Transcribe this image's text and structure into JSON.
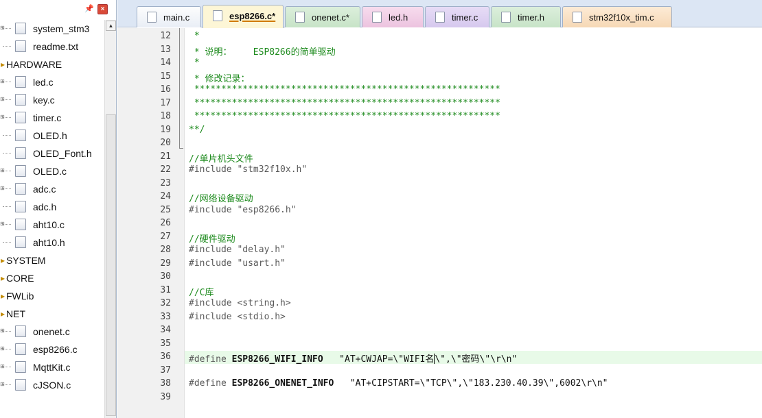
{
  "tree": {
    "items": [
      {
        "kind": "file",
        "label": "system_stm3",
        "expand": "+"
      },
      {
        "kind": "file",
        "label": "readme.txt",
        "expand": ""
      },
      {
        "kind": "group",
        "label": "HARDWARE"
      },
      {
        "kind": "file",
        "label": "led.c",
        "expand": "+"
      },
      {
        "kind": "file",
        "label": "key.c",
        "expand": "+"
      },
      {
        "kind": "file",
        "label": "timer.c",
        "expand": "+"
      },
      {
        "kind": "file",
        "label": "OLED.h",
        "expand": ""
      },
      {
        "kind": "file",
        "label": "OLED_Font.h",
        "expand": ""
      },
      {
        "kind": "file",
        "label": "OLED.c",
        "expand": "+"
      },
      {
        "kind": "file",
        "label": "adc.c",
        "expand": "+"
      },
      {
        "kind": "file",
        "label": "adc.h",
        "expand": ""
      },
      {
        "kind": "file",
        "label": "aht10.c",
        "expand": "+"
      },
      {
        "kind": "file",
        "label": "aht10.h",
        "expand": ""
      },
      {
        "kind": "group",
        "label": "SYSTEM"
      },
      {
        "kind": "group",
        "label": "CORE"
      },
      {
        "kind": "group",
        "label": "FWLib"
      },
      {
        "kind": "group",
        "label": "NET"
      },
      {
        "kind": "file",
        "label": "onenet.c",
        "expand": "+"
      },
      {
        "kind": "file",
        "label": "esp8266.c",
        "expand": "+"
      },
      {
        "kind": "file",
        "label": "MqttKit.c",
        "expand": "+"
      },
      {
        "kind": "file",
        "label": "cJSON.c",
        "expand": "+"
      }
    ]
  },
  "tabs": [
    {
      "label": "main.c",
      "style": "plain",
      "active": false
    },
    {
      "label": "esp8266.c*",
      "style": "active",
      "active": true
    },
    {
      "label": "onenet.c*",
      "style": "green",
      "active": false
    },
    {
      "label": "led.h",
      "style": "pink",
      "active": false
    },
    {
      "label": "timer.c",
      "style": "purple",
      "active": false
    },
    {
      "label": "timer.h",
      "style": "green",
      "active": false
    },
    {
      "label": "stm32f10x_tim.c",
      "style": "orange",
      "active": false
    }
  ],
  "editor": {
    "highlighted_line": 36,
    "lines": [
      {
        "n": "12",
        "parts": [
          {
            "t": " *",
            "c": "comment"
          }
        ]
      },
      {
        "n": "13",
        "parts": [
          {
            "t": " * 说明：    ESP8266的简单驱动",
            "c": "comment"
          }
        ]
      },
      {
        "n": "14",
        "parts": [
          {
            "t": " *",
            "c": "comment"
          }
        ]
      },
      {
        "n": "15",
        "parts": [
          {
            "t": " * 修改记录：",
            "c": "comment"
          }
        ]
      },
      {
        "n": "16",
        "parts": [
          {
            "t": " *********************************************************",
            "c": "comment"
          }
        ]
      },
      {
        "n": "17",
        "parts": [
          {
            "t": " *********************************************************",
            "c": "comment"
          }
        ]
      },
      {
        "n": "18",
        "parts": [
          {
            "t": " *********************************************************",
            "c": "comment"
          }
        ]
      },
      {
        "n": "19",
        "parts": [
          {
            "t": "**/",
            "c": "comment"
          }
        ]
      },
      {
        "n": "20",
        "parts": []
      },
      {
        "n": "21",
        "parts": [
          {
            "t": "//单片机头文件",
            "c": "comment"
          }
        ]
      },
      {
        "n": "22",
        "parts": [
          {
            "t": "#include \"stm32f10x.h\"",
            "c": "pre"
          }
        ]
      },
      {
        "n": "23",
        "parts": []
      },
      {
        "n": "24",
        "parts": [
          {
            "t": "//网络设备驱动",
            "c": "comment"
          }
        ]
      },
      {
        "n": "25",
        "parts": [
          {
            "t": "#include \"esp8266.h\"",
            "c": "pre"
          }
        ]
      },
      {
        "n": "26",
        "parts": []
      },
      {
        "n": "27",
        "parts": [
          {
            "t": "//硬件驱动",
            "c": "comment"
          }
        ]
      },
      {
        "n": "28",
        "parts": [
          {
            "t": "#include \"delay.h\"",
            "c": "pre"
          }
        ]
      },
      {
        "n": "29",
        "parts": [
          {
            "t": "#include \"usart.h\"",
            "c": "pre"
          }
        ]
      },
      {
        "n": "30",
        "parts": []
      },
      {
        "n": "31",
        "parts": [
          {
            "t": "//C库",
            "c": "comment"
          }
        ]
      },
      {
        "n": "32",
        "parts": [
          {
            "t": "#include <string.h>",
            "c": "pre"
          }
        ]
      },
      {
        "n": "33",
        "parts": [
          {
            "t": "#include <stdio.h>",
            "c": "pre"
          }
        ]
      },
      {
        "n": "34",
        "parts": []
      },
      {
        "n": "35",
        "parts": []
      },
      {
        "n": "36",
        "parts": [
          {
            "t": "#define ",
            "c": "define"
          },
          {
            "t": "ESP8266_WIFI_INFO",
            "c": "ident"
          },
          {
            "t": "   \"AT+CWJAP=\\\"WIFI名",
            "c": "string"
          },
          {
            "t": "",
            "c": "caret"
          },
          {
            "t": "\\\",\\\"密码\\\"\\r\\n\"",
            "c": "string"
          }
        ]
      },
      {
        "n": "37",
        "parts": []
      },
      {
        "n": "38",
        "parts": [
          {
            "t": "#define ",
            "c": "define"
          },
          {
            "t": "ESP8266_ONENET_INFO",
            "c": "ident"
          },
          {
            "t": "   \"AT+CIPSTART=\\\"TCP\\\",\\\"183.230.40.39\\\",6002\\r\\n\"",
            "c": "string"
          }
        ]
      },
      {
        "n": "39",
        "parts": []
      }
    ]
  }
}
